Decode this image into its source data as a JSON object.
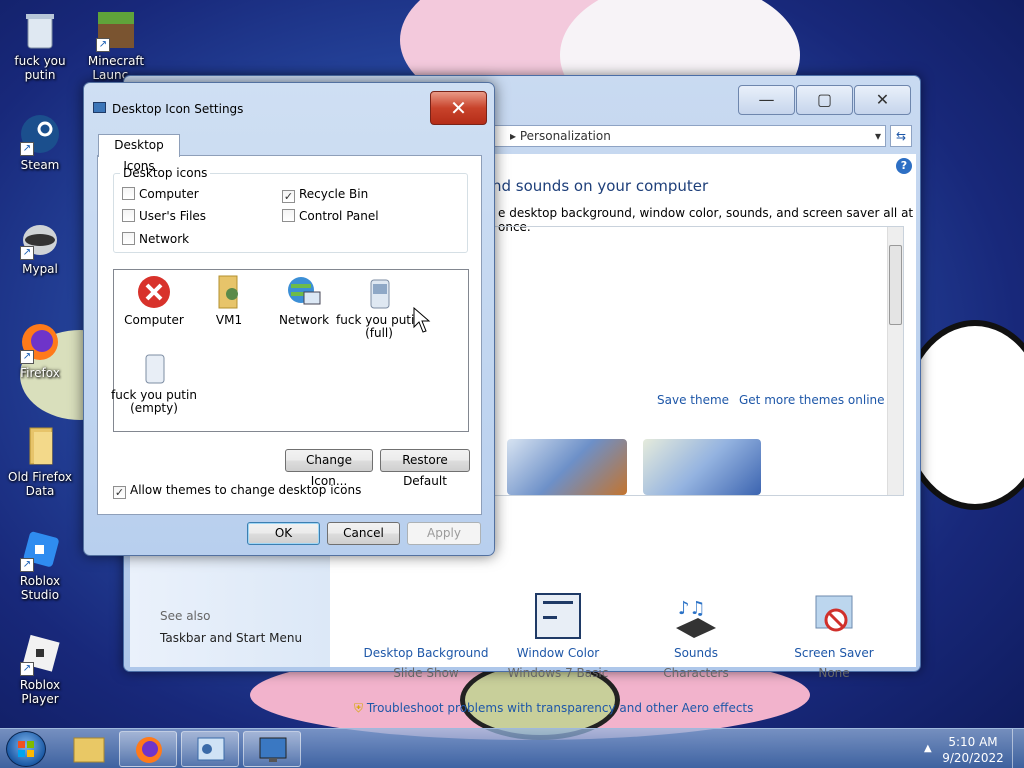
{
  "desktop": {
    "icons": [
      {
        "label": "fuck you putin",
        "name": "recycle-bin"
      },
      {
        "label": "Minecraft Launc...",
        "name": "minecraft"
      },
      {
        "label": "Steam",
        "name": "steam"
      },
      {
        "label": "Mypal",
        "name": "mypal"
      },
      {
        "label": "Firefox",
        "name": "firefox"
      },
      {
        "label": "Old Firefox Data",
        "name": "folder"
      },
      {
        "label": "Roblox Studio",
        "name": "roblox-studio"
      },
      {
        "label": "Roblox Player",
        "name": "roblox-player"
      }
    ]
  },
  "personalization": {
    "address": "Personalization",
    "heading": "nd sounds on your computer",
    "subheading": "e desktop background, window color, sounds, and screen saver all at once.",
    "save_theme": "Save theme",
    "get_more": "Get more themes online",
    "options": [
      {
        "label": "Desktop Background",
        "sub": "Slide Show"
      },
      {
        "label": "Window Color",
        "sub": "Windows 7 Basic"
      },
      {
        "label": "Sounds",
        "sub": "Characters"
      },
      {
        "label": "Screen Saver",
        "sub": "None"
      }
    ],
    "see_also": "See also",
    "taskbar_link": "Taskbar and Start Menu",
    "troubleshoot": "Troubleshoot problems with transparency and other Aero effects"
  },
  "dialog": {
    "title": "Desktop Icon Settings",
    "tab": "Desktop Icons",
    "group_label": "Desktop icons",
    "checkboxes": [
      {
        "label": "Computer",
        "checked": false
      },
      {
        "label": "Recycle Bin",
        "checked": true
      },
      {
        "label": "User's Files",
        "checked": false
      },
      {
        "label": "Control Panel",
        "checked": false
      },
      {
        "label": "Network",
        "checked": false
      }
    ],
    "list_items": [
      {
        "label": "Computer"
      },
      {
        "label": "VM1"
      },
      {
        "label": "Network"
      },
      {
        "label": "fuck you putin (full)"
      },
      {
        "label": "fuck you putin (empty)"
      }
    ],
    "change_icon": "Change Icon...",
    "restore_default": "Restore Default",
    "allow_themes": "Allow themes to change desktop icons",
    "ok": "OK",
    "cancel": "Cancel",
    "apply": "Apply"
  },
  "taskbar": {
    "time": "5:10 AM",
    "date": "9/20/2022"
  }
}
